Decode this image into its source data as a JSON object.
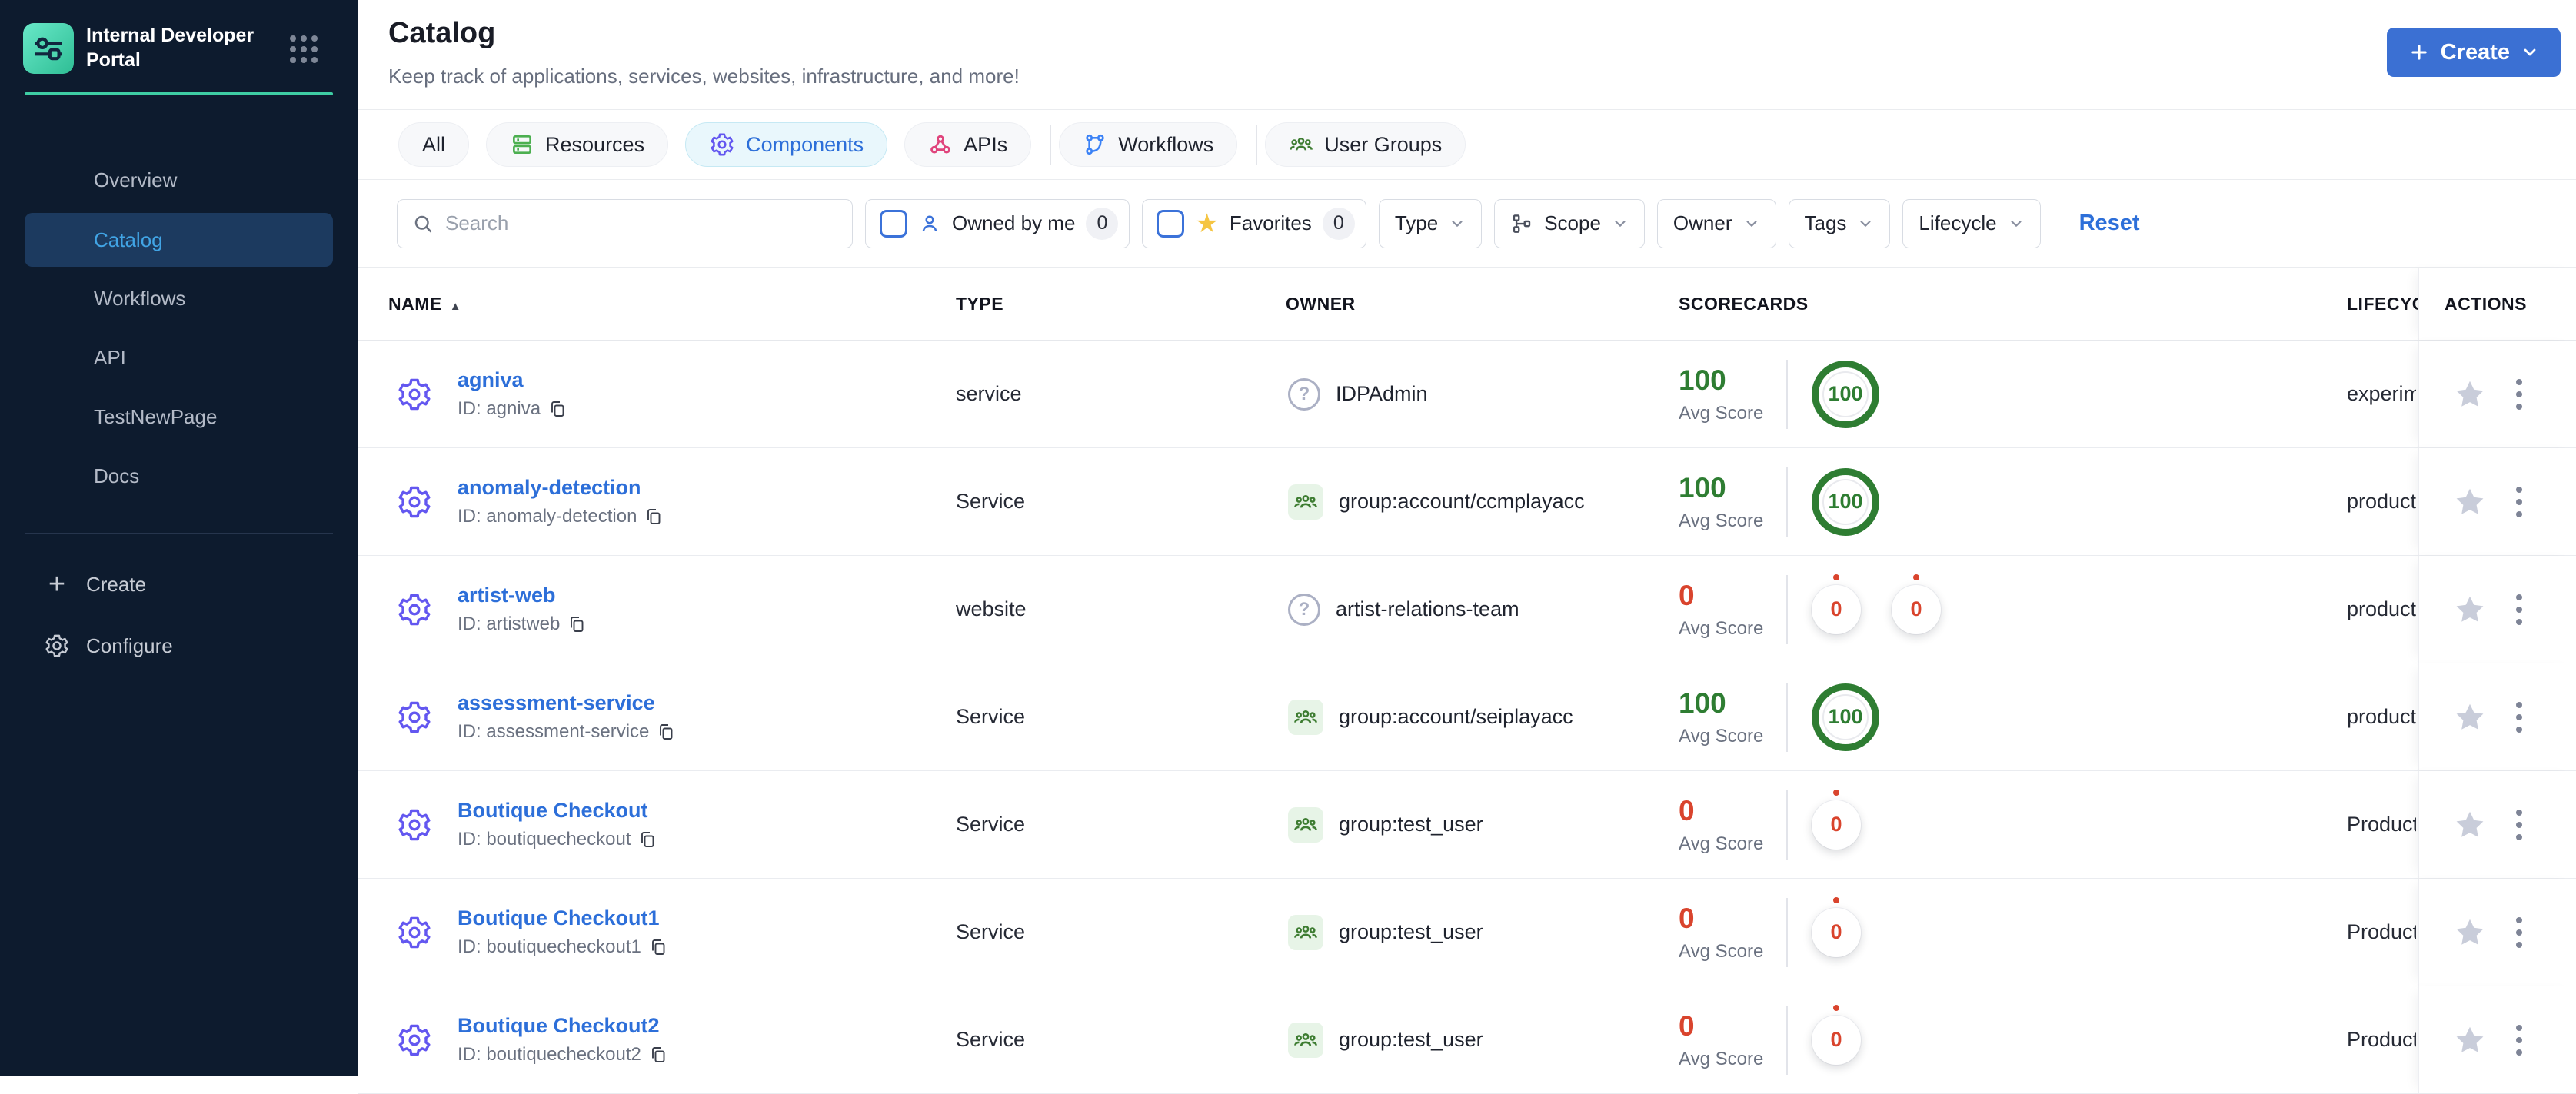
{
  "brand": {
    "title": "Internal Developer Portal"
  },
  "sidebar": {
    "items": [
      {
        "label": "Overview",
        "active": false
      },
      {
        "label": "Catalog",
        "active": true
      },
      {
        "label": "Workflows",
        "active": false
      },
      {
        "label": "API",
        "active": false
      },
      {
        "label": "TestNewPage",
        "active": false
      },
      {
        "label": "Docs",
        "active": false
      }
    ],
    "create_label": "Create",
    "configure_label": "Configure"
  },
  "header": {
    "title": "Catalog",
    "subtitle": "Keep track of applications, services, websites, infrastructure, and more!",
    "create_button_label": "Create"
  },
  "tabs": [
    {
      "label": "All",
      "active": false
    },
    {
      "label": "Resources",
      "icon": "resources-icon",
      "active": false
    },
    {
      "label": "Components",
      "icon": "components-icon",
      "active": true
    },
    {
      "label": "APIs",
      "icon": "apis-icon",
      "active": false
    },
    {
      "label": "Workflows",
      "icon": "workflows-icon",
      "active": false,
      "divider_before": true
    },
    {
      "label": "User Groups",
      "icon": "user-groups-icon",
      "active": false,
      "divider_before": true
    }
  ],
  "filters": {
    "search_placeholder": "Search",
    "owned_by_me": {
      "label": "Owned by me",
      "count": "0",
      "checked": false
    },
    "favorites": {
      "label": "Favorites",
      "count": "0",
      "checked": false
    },
    "dropdowns": [
      {
        "label": "Type"
      },
      {
        "label": "Scope",
        "icon": "scope-icon"
      },
      {
        "label": "Owner"
      },
      {
        "label": "Tags"
      },
      {
        "label": "Lifecycle"
      }
    ],
    "reset_label": "Reset"
  },
  "table": {
    "columns": {
      "name": "NAME",
      "type": "TYPE",
      "owner": "OWNER",
      "scorecards": "SCORECARDS",
      "lifecycle": "LIFECYCLE",
      "actions": "ACTIONS"
    },
    "sort_column": "NAME",
    "avg_score_label": "Avg Score",
    "rows": [
      {
        "name": "agniva",
        "id": "ID: agniva",
        "type": "service",
        "owner": "IDPAdmin",
        "owner_icon": "question",
        "avg_score": "100",
        "score_color": "green",
        "rings": [
          {
            "value": "100",
            "type": "green"
          }
        ],
        "lifecycle": "experimental"
      },
      {
        "name": "anomaly-detection",
        "id": "ID: anomaly-detection",
        "type": "Service",
        "owner": "group:account/ccmplayacc",
        "owner_icon": "group",
        "avg_score": "100",
        "score_color": "green",
        "rings": [
          {
            "value": "100",
            "type": "green"
          }
        ],
        "lifecycle": "production"
      },
      {
        "name": "artist-web",
        "id": "ID: artistweb",
        "type": "website",
        "owner": "artist-relations-team",
        "owner_icon": "question",
        "avg_score": "0",
        "score_color": "red",
        "rings": [
          {
            "value": "0",
            "type": "zero"
          },
          {
            "value": "0",
            "type": "zero"
          }
        ],
        "lifecycle": "production"
      },
      {
        "name": "assessment-service",
        "id": "ID: assessment-service",
        "type": "Service",
        "owner": "group:account/seiplayacc",
        "owner_icon": "group",
        "avg_score": "100",
        "score_color": "green",
        "rings": [
          {
            "value": "100",
            "type": "green"
          }
        ],
        "lifecycle": "production"
      },
      {
        "name": "Boutique Checkout",
        "id": "ID: boutiquecheckout",
        "type": "Service",
        "owner": "group:test_user",
        "owner_icon": "group",
        "avg_score": "0",
        "score_color": "red",
        "rings": [
          {
            "value": "0",
            "type": "zero"
          }
        ],
        "lifecycle": "Production"
      },
      {
        "name": "Boutique Checkout1",
        "id": "ID: boutiquecheckout1",
        "type": "Service",
        "owner": "group:test_user",
        "owner_icon": "group",
        "avg_score": "0",
        "score_color": "red",
        "rings": [
          {
            "value": "0",
            "type": "zero"
          }
        ],
        "lifecycle": "Production"
      },
      {
        "name": "Boutique Checkout2",
        "id": "ID: boutiquecheckout2",
        "type": "Service",
        "owner": "group:test_user",
        "owner_icon": "group",
        "avg_score": "0",
        "score_color": "red",
        "rings": [
          {
            "value": "0",
            "type": "zero"
          }
        ],
        "lifecycle": "Production"
      }
    ]
  },
  "colors": {
    "sidebar_bg": "#0D1B2E",
    "sidebar_active_bg": "#1C3A5F",
    "sidebar_active_text": "#41A4E5",
    "teal_accent": "#3ECDA4",
    "accent_blue": "#2D6FD9",
    "create_button": "#3B70D3",
    "score_green": "#2E7D32",
    "score_red": "#D9442D",
    "component_purple": "#6357F0",
    "favorites_star": "#F5C542"
  }
}
